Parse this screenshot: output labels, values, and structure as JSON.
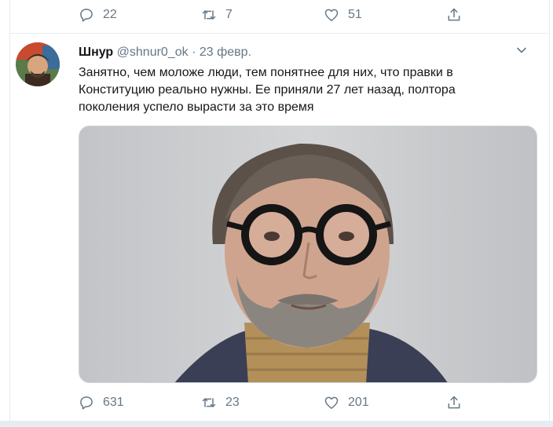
{
  "prev_tweet": {
    "reply_count": "22",
    "retweet_count": "7",
    "like_count": "51"
  },
  "tweet": {
    "author_name": "Шнур",
    "handle": "@shnur0_ok",
    "separator": "·",
    "date": "23 февр.",
    "text_lines": [
      "Занятно, чем моложе люди, тем понятнее для них, что правки в",
      "Конституцию реально нужны. Ее приняли 27 лет назад, полтора",
      "поколения успело вырасти за это время"
    ],
    "reply_count": "631",
    "retweet_count": "23",
    "like_count": "201"
  },
  "icons": {
    "reply": "reply-icon",
    "retweet": "retweet-icon",
    "like": "heart-icon",
    "share": "share-icon",
    "more": "chevron-down-icon"
  },
  "colors": {
    "icon_gray": "#657786",
    "border": "#e6ecf0"
  }
}
